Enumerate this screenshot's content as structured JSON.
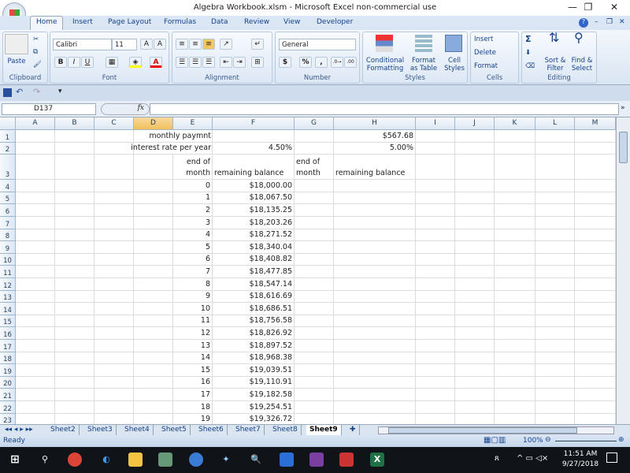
{
  "window": {
    "title": "Algebra Workbook.xlsm - Microsoft Excel non-commercial use",
    "minimize": "—",
    "restore": "❐",
    "close": "✕"
  },
  "ribbon_tabs": [
    "Home",
    "Insert",
    "Page Layout",
    "Formulas",
    "Data",
    "Review",
    "View",
    "Developer"
  ],
  "ribbon": {
    "clipboard": {
      "label": "Clipboard",
      "paste": "Paste"
    },
    "font": {
      "label": "Font",
      "name": "Calibri",
      "size": "11",
      "bold": "B",
      "italic": "I",
      "underline": "U"
    },
    "alignment": {
      "label": "Alignment"
    },
    "number": {
      "label": "Number",
      "format": "General",
      "currency": "$",
      "percent": "%",
      "comma": ","
    },
    "styles": {
      "label": "Styles",
      "conditional": "Conditional Formatting",
      "format_table": "Format as Table",
      "cell_styles": "Cell Styles"
    },
    "cells": {
      "label": "Cells",
      "insert": "Insert",
      "delete": "Delete",
      "format": "Format"
    },
    "editing": {
      "label": "Editing",
      "sum": "Σ",
      "sort": "Sort & Filter",
      "find": "Find & Select"
    }
  },
  "formula_bar": {
    "name_box": "D137",
    "fx": "fx",
    "formula": ""
  },
  "columns": [
    "A",
    "B",
    "C",
    "D",
    "E",
    "F",
    "G",
    "H",
    "I",
    "J",
    "K",
    "L",
    "M"
  ],
  "selected_column": "D",
  "rows": [
    {
      "n": "1",
      "cells": {
        "D": "monthly paymnt",
        "H": "$567.68"
      }
    },
    {
      "n": "2",
      "cells": {
        "D": "interest rate per year",
        "F": "4.50%",
        "H": "5.00%"
      }
    },
    {
      "n": "3",
      "cells": {
        "E": "end of\nmonth",
        "F": "remaining balance",
        "G": "end of\nmonth",
        "H": "remaining balance"
      }
    },
    {
      "n": "4",
      "cells": {
        "E": "0",
        "F": "$18,000.00"
      }
    },
    {
      "n": "5",
      "cells": {
        "E": "1",
        "F": "$18,067.50"
      }
    },
    {
      "n": "6",
      "cells": {
        "E": "2",
        "F": "$18,135.25"
      }
    },
    {
      "n": "7",
      "cells": {
        "E": "3",
        "F": "$18,203.26"
      }
    },
    {
      "n": "8",
      "cells": {
        "E": "4",
        "F": "$18,271.52"
      }
    },
    {
      "n": "9",
      "cells": {
        "E": "5",
        "F": "$18,340.04"
      }
    },
    {
      "n": "10",
      "cells": {
        "E": "6",
        "F": "$18,408.82"
      }
    },
    {
      "n": "11",
      "cells": {
        "E": "7",
        "F": "$18,477.85"
      }
    },
    {
      "n": "12",
      "cells": {
        "E": "8",
        "F": "$18,547.14"
      }
    },
    {
      "n": "13",
      "cells": {
        "E": "9",
        "F": "$18,616.69"
      }
    },
    {
      "n": "14",
      "cells": {
        "E": "10",
        "F": "$18,686.51"
      }
    },
    {
      "n": "15",
      "cells": {
        "E": "11",
        "F": "$18,756.58"
      }
    },
    {
      "n": "16",
      "cells": {
        "E": "12",
        "F": "$18,826.92"
      }
    },
    {
      "n": "17",
      "cells": {
        "E": "13",
        "F": "$18,897.52"
      }
    },
    {
      "n": "18",
      "cells": {
        "E": "14",
        "F": "$18,968.38"
      }
    },
    {
      "n": "19",
      "cells": {
        "E": "15",
        "F": "$19,039.51"
      }
    },
    {
      "n": "20",
      "cells": {
        "E": "16",
        "F": "$19,110.91"
      }
    },
    {
      "n": "21",
      "cells": {
        "E": "17",
        "F": "$19,182.58"
      }
    },
    {
      "n": "22",
      "cells": {
        "E": "18",
        "F": "$19,254.51"
      }
    },
    {
      "n": "23",
      "cells": {
        "E": "19",
        "F": "$19,326.72"
      }
    }
  ],
  "sheet_tabs": [
    "Sheet2",
    "Sheet3",
    "Sheet4",
    "Sheet5",
    "Sheet6",
    "Sheet7",
    "Sheet8",
    "Sheet9"
  ],
  "active_sheet": "Sheet9",
  "status": {
    "text": "Ready",
    "zoom": "100%"
  },
  "taskbar": {
    "time": "11:51 AM",
    "date": "9/27/2018"
  },
  "colors": {
    "accent": "#15428b",
    "selected_header": "#f1c05c"
  }
}
